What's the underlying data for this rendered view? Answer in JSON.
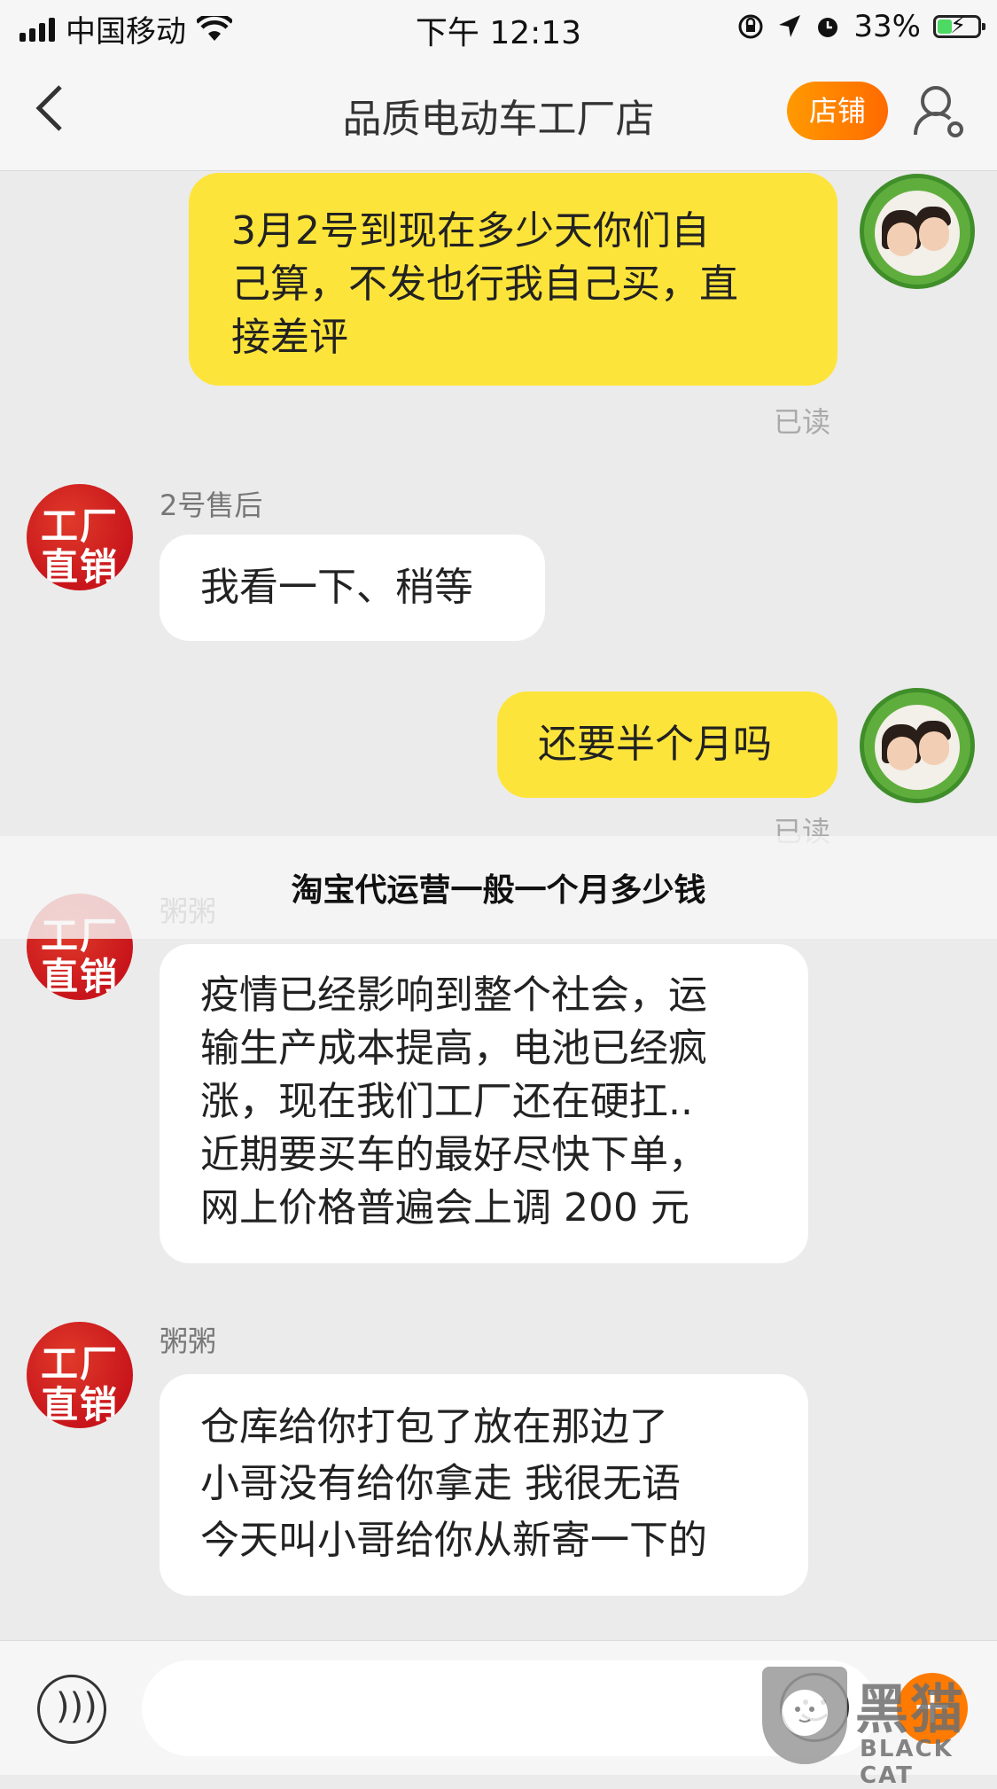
{
  "status_bar": {
    "carrier": "中国移动",
    "time": "下午 12:13",
    "battery_percent": "33%",
    "battery_level": 0.33
  },
  "nav": {
    "title": "品质电动车工厂店",
    "shop_button": "店铺",
    "back_icon": "chevron-left-icon",
    "user_icon": "user-settings-icon"
  },
  "messages": [
    {
      "from": "me",
      "lines": [
        "3月2号到现在多少天你们自",
        "己算，不发也行我自己买，直",
        "接差评"
      ],
      "status": "已读"
    },
    {
      "from": "them",
      "sender": "2号售后",
      "avatar_text": [
        "工厂",
        "直销"
      ],
      "lines": [
        "我看一下、稍等"
      ]
    },
    {
      "from": "me",
      "lines": [
        "还要半个月吗"
      ],
      "status": "已读"
    },
    {
      "from": "them",
      "sender": "粥粥",
      "avatar_text": [
        "工厂",
        "直销"
      ],
      "lines": [
        "疫情已经影响到整个社会，运",
        "输生产成本提高，电池已经疯",
        "涨，现在我们工厂还在硬扛..",
        "近期要买车的最好尽快下单，",
        "网上价格普遍会上调 200 元"
      ]
    },
    {
      "from": "them",
      "sender": "粥粥",
      "avatar_text": [
        "工厂",
        "直销"
      ],
      "lines": [
        "仓库给你打包了放在那边了",
        "小哥没有给你拿走  我很无语",
        "今天叫小哥给你从新寄一下的"
      ]
    }
  ],
  "overlay": {
    "text": "淘宝代运营一般一个月多少钱"
  },
  "input_bar": {
    "placeholder": "",
    "voice_icon": "voice-icon",
    "emoji_icon": "emoji-icon",
    "plus_icon": "plus-icon"
  },
  "watermark": {
    "cn": "黑猫",
    "en": "BLACK CAT"
  },
  "colors": {
    "my_bubble": "#fde43a",
    "their_bubble": "#ffffff",
    "shop_button": "#ff7a00",
    "avatar_red": "#c8151b"
  }
}
